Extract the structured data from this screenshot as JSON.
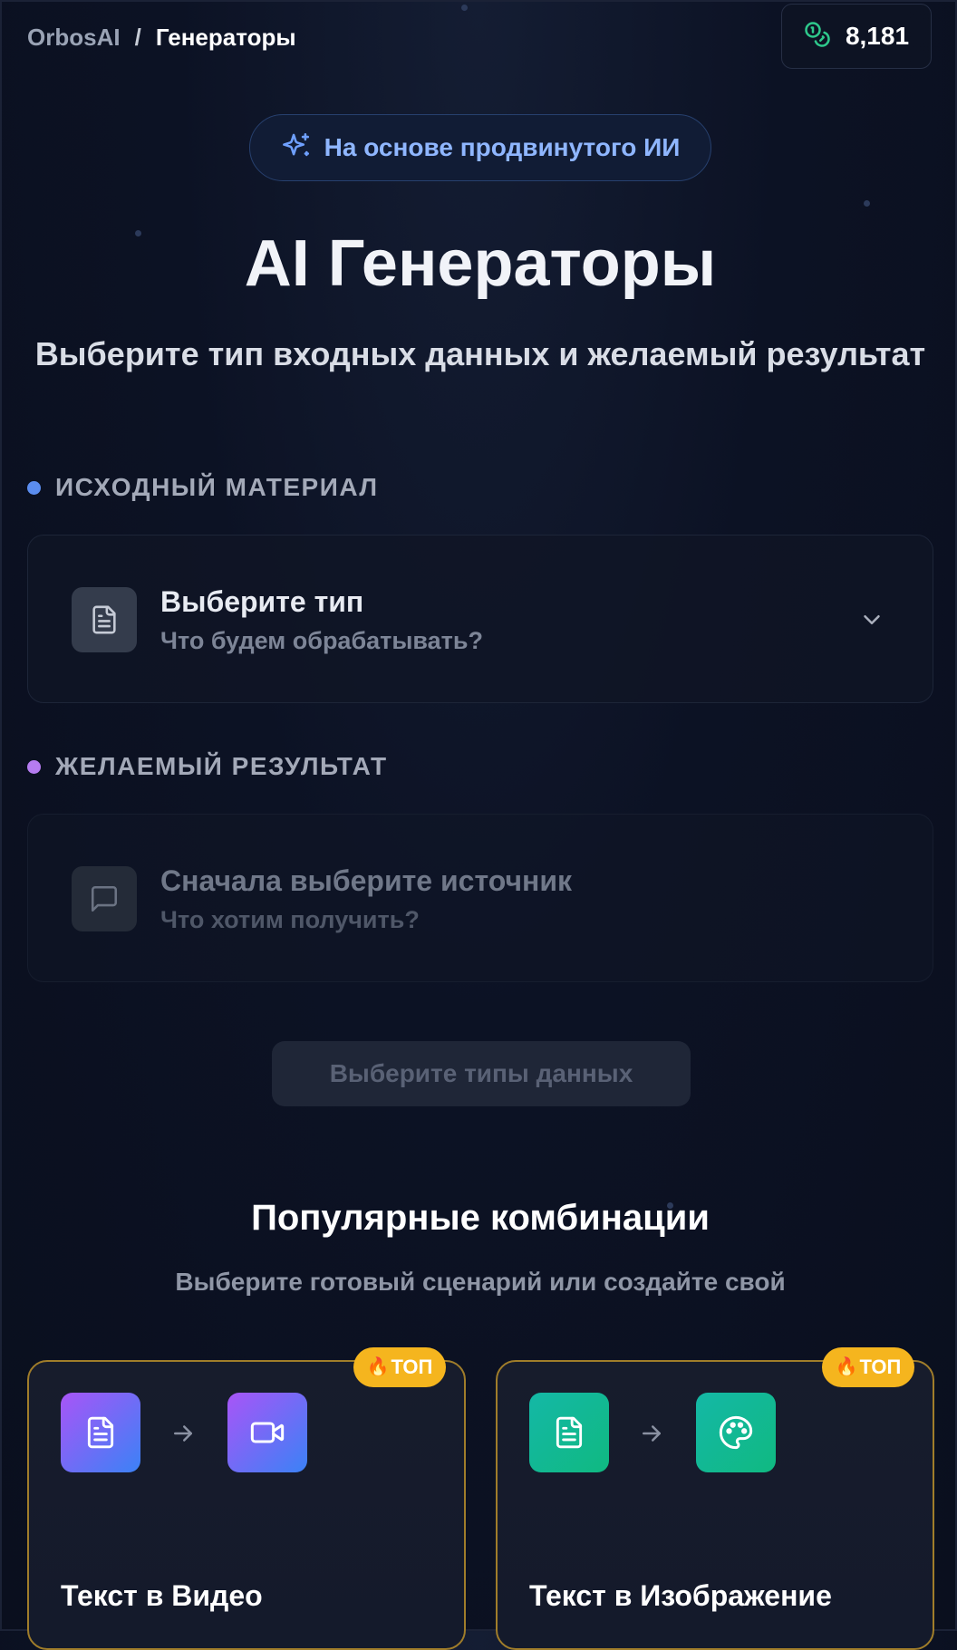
{
  "header": {
    "breadcrumb_root": "OrbosAI",
    "breadcrumb_separator": "/",
    "breadcrumb_current": "Генераторы",
    "credits_value": "8,181",
    "credits_icon": "coins-icon"
  },
  "hero": {
    "pill_label": "На основе продвинутого ИИ",
    "pill_icon": "sparkles-icon",
    "title": "AI Генераторы",
    "subtitle": "Выберите тип входных данных и желаемый результат"
  },
  "source_section": {
    "label": "ИСХОДНЫЙ МАТЕРИАЛ",
    "dot_color": "#5b8def",
    "selector_title": "Выберите тип",
    "selector_subtitle": "Что будем обрабатывать?",
    "icon": "document-icon"
  },
  "result_section": {
    "label": "ЖЕЛАЕМЫЙ РЕЗУЛЬТАТ",
    "dot_color": "#b57cf0",
    "selector_title": "Сначала выберите источник",
    "selector_subtitle": "Что хотим получить?",
    "icon": "message-icon"
  },
  "submit_button_label": "Выберите типы данных",
  "popular": {
    "title": "Популярные комбинации",
    "subtitle": "Выберите готовый сценарий или создайте свой",
    "cards": [
      {
        "title": "Текст в Видео",
        "badge": "ТОП",
        "from_icon": "document-icon",
        "to_icon": "video-icon"
      },
      {
        "title": "Текст в Изображение",
        "badge": "ТОП",
        "from_icon": "document-icon",
        "to_icon": "palette-icon"
      }
    ]
  },
  "colors": {
    "accent_blue": "#8fb6ff",
    "badge_gold": "#f5b51e",
    "card_border_gold": "#a07d2a",
    "credits_green": "#2ec98c"
  }
}
